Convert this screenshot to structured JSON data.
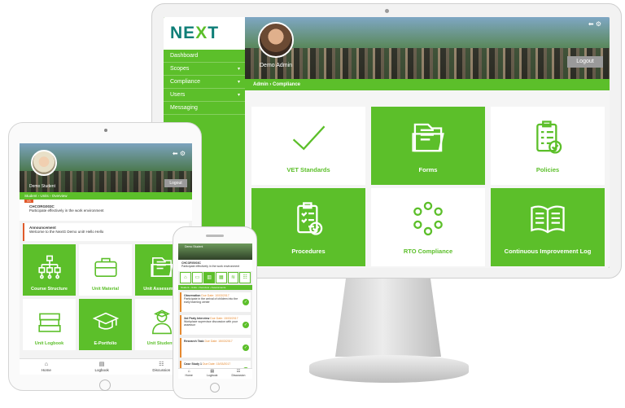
{
  "colors": {
    "brand_green": "#5cbf2a",
    "logo_teal": "#0e7e77",
    "accent_orange": "#e6892f",
    "logout_grey": "#9a9a9a"
  },
  "desktop": {
    "logo": {
      "text_a": "NE",
      "text_x": "X",
      "text_b": "T"
    },
    "sidebar": [
      {
        "label": "Dashboard",
        "has_caret": false
      },
      {
        "label": "Scopes",
        "has_caret": true
      },
      {
        "label": "Compliance",
        "has_caret": true
      },
      {
        "label": "Users",
        "has_caret": true
      },
      {
        "label": "Messaging",
        "has_caret": false
      }
    ],
    "caret": "▾",
    "user_name": "Demo Admin",
    "logout": "Logout",
    "top_icons": "⬅ ⚙",
    "breadcrumb": "Admin › Compliance",
    "tiles": [
      {
        "label": "VET Standards",
        "icon": "check-icon",
        "style": "w"
      },
      {
        "label": "Forms",
        "icon": "folder-icon",
        "style": "g"
      },
      {
        "label": "Policies",
        "icon": "clipboard-check-icon",
        "style": "w"
      },
      {
        "label": "Procedures",
        "icon": "clipboard-list-icon",
        "style": "g"
      },
      {
        "label": "RTO Compliance",
        "icon": "circle-dots-icon",
        "style": "w"
      },
      {
        "label": "Continuous Improvement Log",
        "icon": "book-icon",
        "style": "g"
      }
    ]
  },
  "tablet": {
    "user_name": "Demo Student",
    "logout": "Logout",
    "top_icons": "⬅ ⚙",
    "breadcrumb": "Student › Units › Overview",
    "badge": "VS",
    "unit_code": "CHCORG003C",
    "unit_desc": "Participate effectively in the work environment",
    "announcement_title": "Announcement",
    "announcement_text": "Welcome to the NextG Demo unit! Hello Hello",
    "tiles": [
      {
        "label": "Course Structure",
        "icon": "hierarchy-icon",
        "style": "g"
      },
      {
        "label": "Unit Material",
        "icon": "briefcase-icon",
        "style": "w"
      },
      {
        "label": "Unit Assessment",
        "icon": "folder-icon",
        "style": "g"
      },
      {
        "label": "Unit Logbook",
        "icon": "books-icon",
        "style": "w"
      },
      {
        "label": "E-Portfolio",
        "icon": "graduation-cap-icon",
        "style": "g"
      },
      {
        "label": "Unit Students",
        "icon": "student-icon",
        "style": "w"
      }
    ],
    "tabs": [
      {
        "label": "Home",
        "glyph": "⌂"
      },
      {
        "label": "Logbook",
        "glyph": "▤"
      },
      {
        "label": "Discussion",
        "glyph": "☷"
      }
    ]
  },
  "phone": {
    "user_name": "Demo Student",
    "unit_code": "CHCORG003C",
    "unit_desc": "Participate effectively in the work environment",
    "icons": [
      "⌂",
      "▭",
      "▥",
      "▦",
      "≋",
      "☷"
    ],
    "breadcrumb": "Student › Units › Overview › Assessments",
    "items": [
      {
        "title": "Observation",
        "date": "Due Date: 10/03/2017",
        "desc": "Participate in the arrival of children into the early learning center"
      },
      {
        "title": "3rd Party Interview",
        "date": "Due Date: 15/03/2017",
        "desc": "Workplace supervisor discussion with your assessor"
      },
      {
        "title": "Research Task",
        "date": "Due Date: 15/03/2017",
        "desc": ""
      },
      {
        "title": "Case Study 1",
        "date": "Due Date: 15/03/2017",
        "desc": ""
      }
    ],
    "check": "✓",
    "tabs": [
      {
        "label": "Home",
        "glyph": "⌂"
      },
      {
        "label": "Logbook",
        "glyph": "▤"
      },
      {
        "label": "Discussion",
        "glyph": "☷"
      }
    ]
  }
}
